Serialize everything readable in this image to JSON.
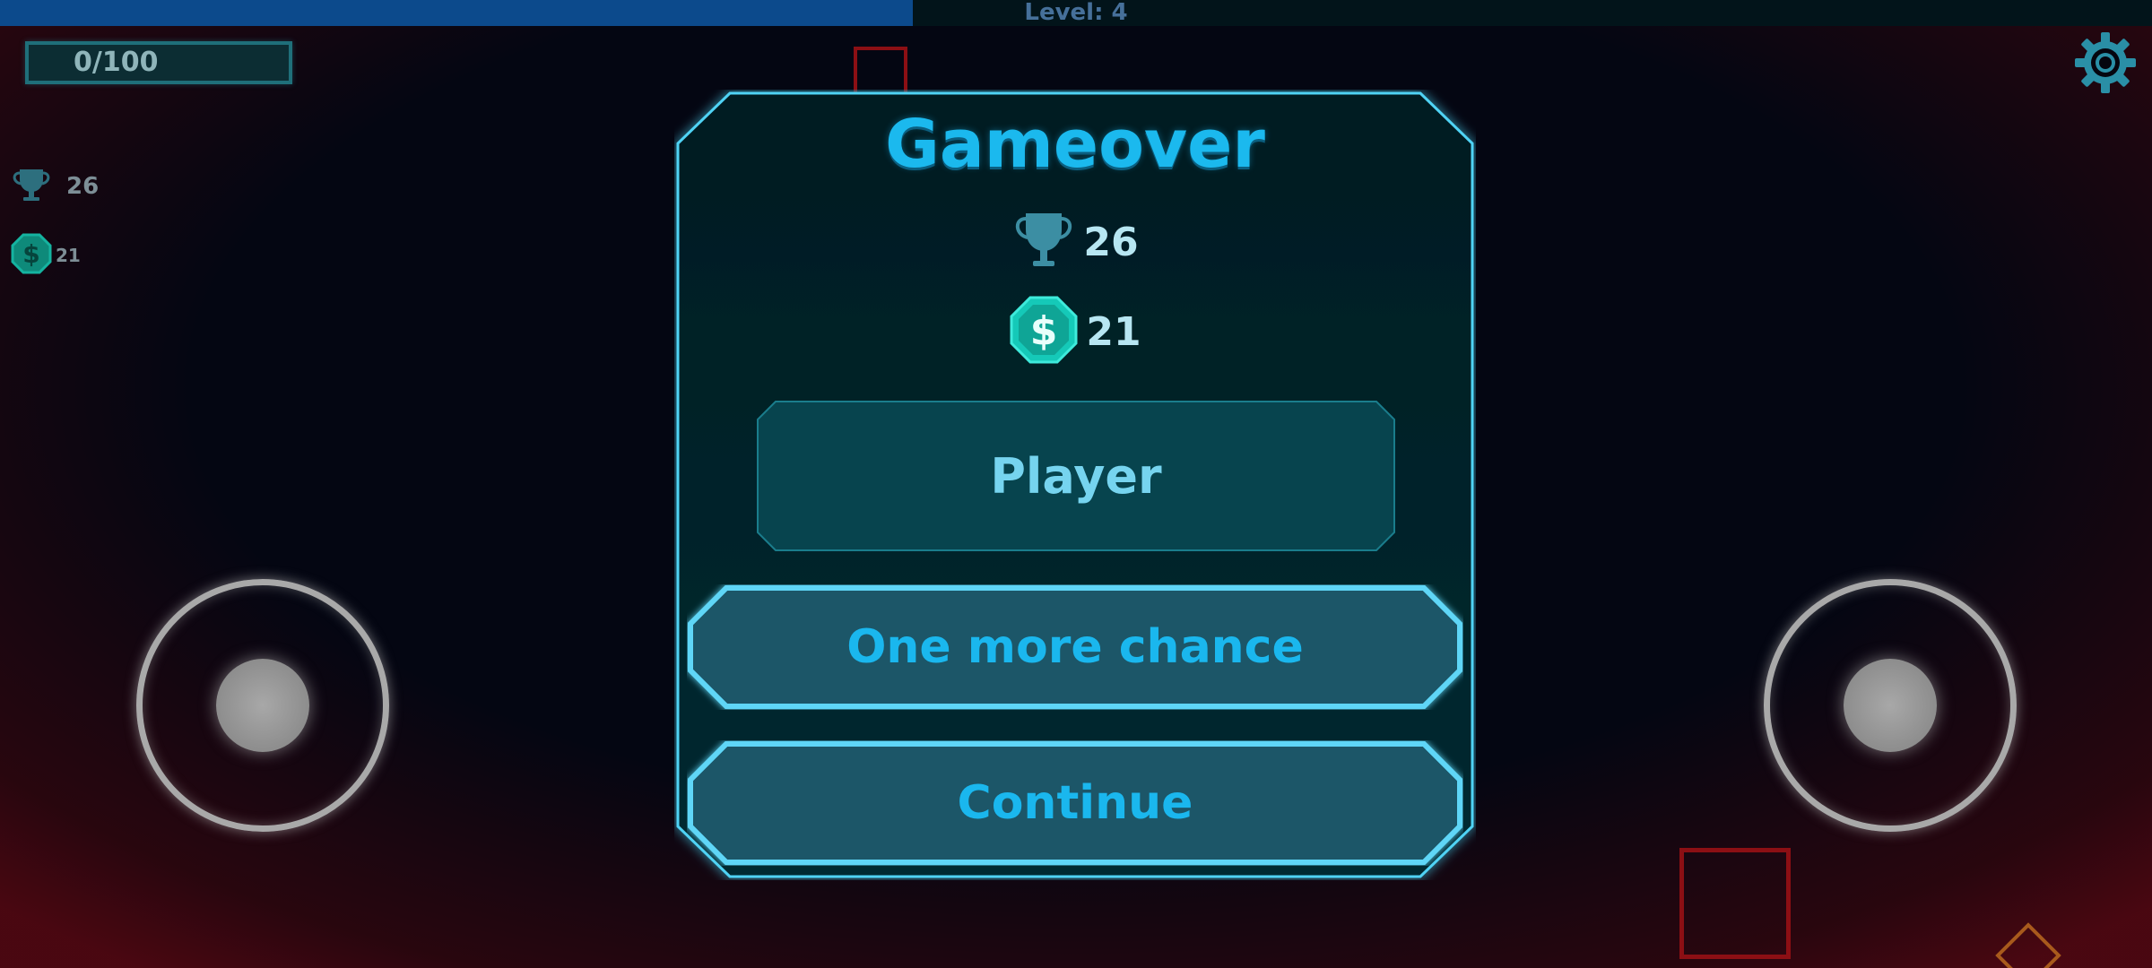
{
  "hud": {
    "level_text": "Level: 4",
    "level_progress": 0.424,
    "progress_text": "0/100",
    "trophy_count": "26",
    "coin_count": "21"
  },
  "dialog": {
    "title": "Gameover",
    "trophy_count": "26",
    "coin_count": "21",
    "player_label": "Player",
    "one_more_chance_label": "One more chance",
    "continue_label": "Continue"
  },
  "colors": {
    "accent": "#1bb9ee",
    "panel": "#042026",
    "frame_glow": "#4fd3f5",
    "coin": "#15c9b8",
    "danger_outline": "#8c0f14"
  },
  "icons": [
    "trophy-icon",
    "coin-icon",
    "gear-icon",
    "joystick-left",
    "joystick-right"
  ]
}
